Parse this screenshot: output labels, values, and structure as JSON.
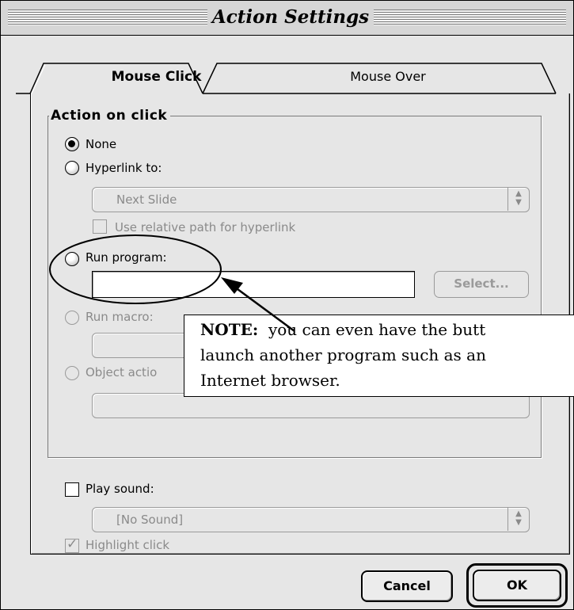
{
  "window": {
    "title": "Action Settings"
  },
  "tabs": [
    {
      "label": "Mouse Click",
      "selected": true
    },
    {
      "label": "Mouse Over",
      "selected": false
    }
  ],
  "action_group": {
    "legend": "Action on click",
    "options": {
      "none": {
        "label": "None",
        "selected": true,
        "enabled": true
      },
      "hyperlink": {
        "label": "Hyperlink to:",
        "selected": false,
        "enabled": true
      },
      "run_program": {
        "label": "Run program:",
        "selected": false,
        "enabled": true
      },
      "run_macro": {
        "label": "Run macro:",
        "selected": false,
        "enabled": false
      },
      "object_action": {
        "label": "Object actio",
        "selected": false,
        "enabled": false
      }
    },
    "hyperlink_popup": {
      "value": "Next Slide"
    },
    "relative_path": {
      "label": "Use relative path for hyperlink",
      "checked": false,
      "enabled": false
    },
    "run_program_field": {
      "value": ""
    },
    "select_button": {
      "label": "Select..."
    },
    "run_macro_popup": {
      "value": ""
    },
    "object_action_popup": {
      "value": ""
    }
  },
  "sound": {
    "play_label": "Play sound:",
    "checked": false,
    "popup_value": "[No Sound]",
    "highlight_label": "Highlight click",
    "highlight_checked": true
  },
  "buttons": {
    "cancel": "Cancel",
    "ok": "OK"
  },
  "annotation": {
    "bold": "NOTE:",
    "line1": "you can even have the butt",
    "line2": "launch another program such as an",
    "line3": "Internet browser."
  }
}
